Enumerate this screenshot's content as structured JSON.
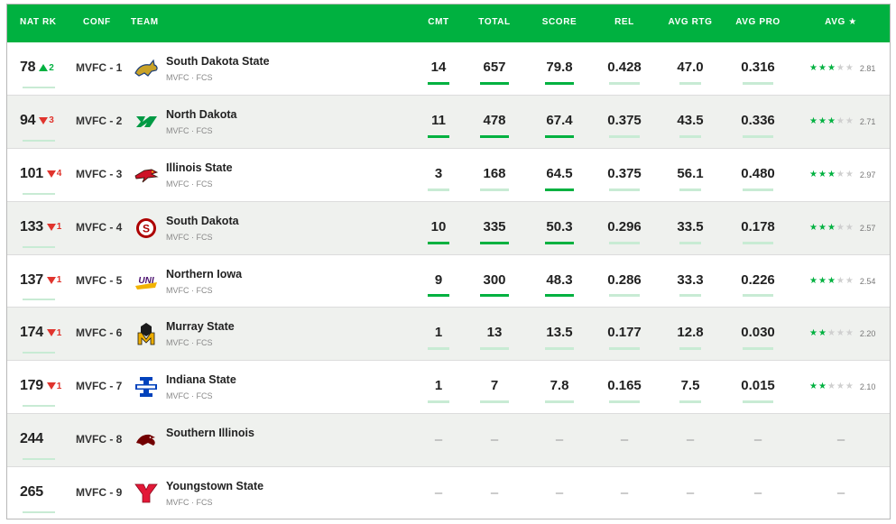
{
  "header": {
    "nat_rk": "NAT RK",
    "conf": "CONF",
    "team": "TEAM",
    "cmt": "CMT",
    "total": "TOTAL",
    "score": "SCORE",
    "rel": "REL",
    "avg_rtg": "AVG RTG",
    "avg_pro": "AVG PRO",
    "avg": "AVG ★"
  },
  "colors": {
    "accent": "#00b140",
    "down": "#e0342d",
    "row_alt": "#eff1ee"
  },
  "rows": [
    {
      "rank": "78",
      "move_dir": "up",
      "move": "2",
      "conf": "MVFC - 1",
      "team": "South Dakota State",
      "sub": "MVFC · FCS",
      "logo": "jackrabbit-logo",
      "cmt": "14",
      "total": "657",
      "score": "79.8",
      "rel": "0.428",
      "avg_rtg": "47.0",
      "avg_pro": "0.316",
      "avg_stars": "2.81",
      "stars_full": 3,
      "stars_half": 0
    },
    {
      "rank": "94",
      "move_dir": "down",
      "move": "3",
      "conf": "MVFC - 2",
      "team": "North Dakota",
      "sub": "MVFC · FCS",
      "logo": "fighting-hawks-logo",
      "cmt": "11",
      "total": "478",
      "score": "67.4",
      "rel": "0.375",
      "avg_rtg": "43.5",
      "avg_pro": "0.336",
      "avg_stars": "2.71",
      "stars_full": 3,
      "stars_half": 0
    },
    {
      "rank": "101",
      "move_dir": "down",
      "move": "4",
      "conf": "MVFC - 3",
      "team": "Illinois State",
      "sub": "MVFC · FCS",
      "logo": "redbird-logo",
      "cmt": "3",
      "total": "168",
      "score": "64.5",
      "rel": "0.375",
      "avg_rtg": "56.1",
      "avg_pro": "0.480",
      "avg_stars": "2.97",
      "stars_full": 3,
      "stars_half": 0
    },
    {
      "rank": "133",
      "move_dir": "down",
      "move": "1",
      "conf": "MVFC - 4",
      "team": "South Dakota",
      "sub": "MVFC · FCS",
      "logo": "coyotes-logo",
      "cmt": "10",
      "total": "335",
      "score": "50.3",
      "rel": "0.296",
      "avg_rtg": "33.5",
      "avg_pro": "0.178",
      "avg_stars": "2.57",
      "stars_full": 2,
      "stars_half": 1
    },
    {
      "rank": "137",
      "move_dir": "down",
      "move": "1",
      "conf": "MVFC - 5",
      "team": "Northern Iowa",
      "sub": "MVFC · FCS",
      "logo": "uni-logo",
      "cmt": "9",
      "total": "300",
      "score": "48.3",
      "rel": "0.286",
      "avg_rtg": "33.3",
      "avg_pro": "0.226",
      "avg_stars": "2.54",
      "stars_full": 2,
      "stars_half": 1
    },
    {
      "rank": "174",
      "move_dir": "down",
      "move": "1",
      "conf": "MVFC - 6",
      "team": "Murray State",
      "sub": "MVFC · FCS",
      "logo": "racers-logo",
      "cmt": "1",
      "total": "13",
      "score": "13.5",
      "rel": "0.177",
      "avg_rtg": "12.8",
      "avg_pro": "0.030",
      "avg_stars": "2.20",
      "stars_full": 2,
      "stars_half": 0
    },
    {
      "rank": "179",
      "move_dir": "down",
      "move": "1",
      "conf": "MVFC - 7",
      "team": "Indiana State",
      "sub": "MVFC · FCS",
      "logo": "sycamores-logo",
      "cmt": "1",
      "total": "7",
      "score": "7.8",
      "rel": "0.165",
      "avg_rtg": "7.5",
      "avg_pro": "0.015",
      "avg_stars": "2.10",
      "stars_full": 2,
      "stars_half": 0
    },
    {
      "rank": "244",
      "move_dir": "",
      "move": "",
      "conf": "MVFC - 8",
      "team": "Southern Illinois",
      "sub": "",
      "logo": "salukis-logo",
      "cmt": "–",
      "total": "–",
      "score": "–",
      "rel": "–",
      "avg_rtg": "–",
      "avg_pro": "–",
      "avg_stars": "–",
      "stars_full": 0,
      "stars_half": 0
    },
    {
      "rank": "265",
      "move_dir": "",
      "move": "",
      "conf": "MVFC - 9",
      "team": "Youngstown State",
      "sub": "MVFC · FCS",
      "logo": "youngstown-y-logo",
      "cmt": "–",
      "total": "–",
      "score": "–",
      "rel": "–",
      "avg_rtg": "–",
      "avg_pro": "–",
      "avg_stars": "–",
      "stars_full": 0,
      "stars_half": 0
    }
  ]
}
